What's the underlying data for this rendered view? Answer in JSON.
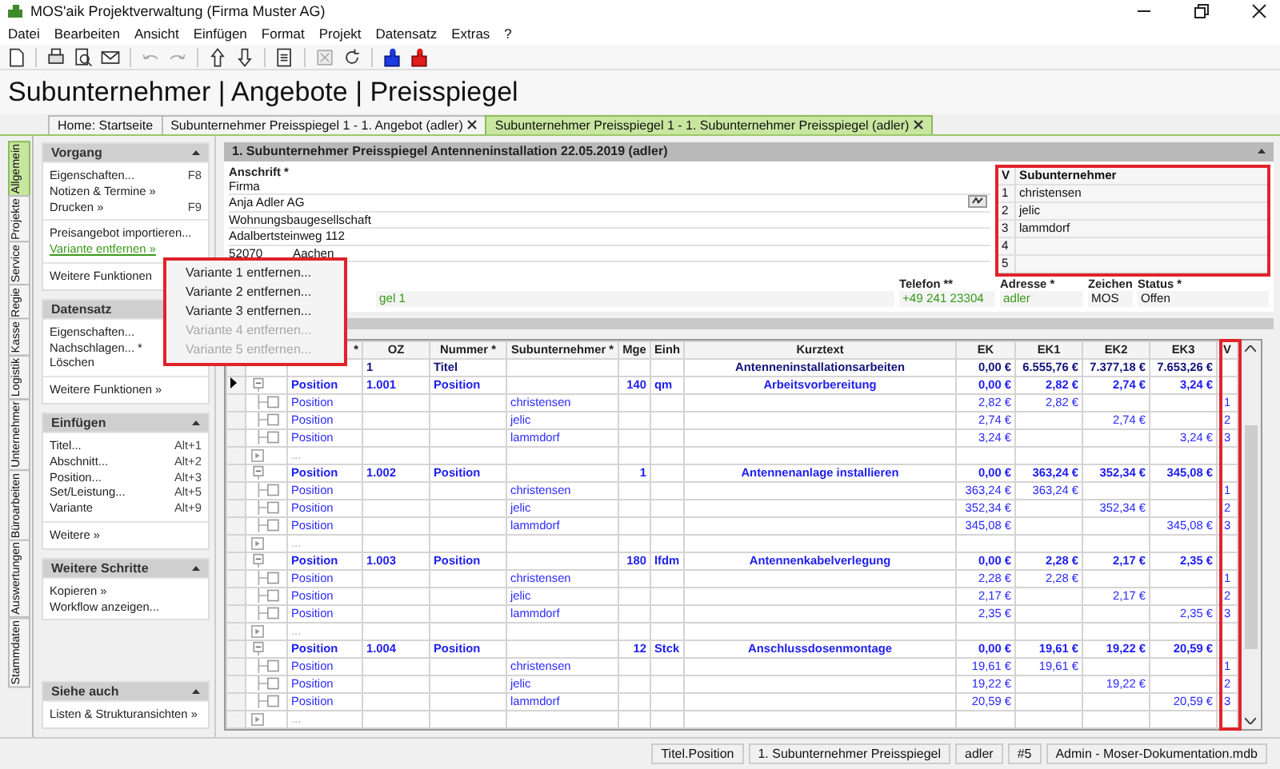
{
  "window": {
    "title": "MOS'aik Projektverwaltung (Firma Muster AG)"
  },
  "menu": [
    "Datei",
    "Bearbeiten",
    "Ansicht",
    "Einfügen",
    "Format",
    "Projekt",
    "Datensatz",
    "Extras",
    "?"
  ],
  "page_title": "Subunternehmer | Angebote | Preisspiegel",
  "tabs": [
    {
      "label": "Home: Startseite",
      "closable": false,
      "selected": false
    },
    {
      "label": "Subunternehmer Preisspiegel 1 - 1. Angebot (adler)",
      "closable": true,
      "selected": false
    },
    {
      "label": "Subunternehmer Preisspiegel 1 - 1. Subunternehmer Preisspiegel (adler)",
      "closable": true,
      "selected": true
    }
  ],
  "side_tabs": [
    {
      "label": "Allgemein",
      "selected": true
    },
    {
      "label": "Projekte",
      "selected": false
    },
    {
      "label": "Service",
      "selected": false
    },
    {
      "label": "Regie",
      "selected": false
    },
    {
      "label": "Kasse",
      "selected": false
    },
    {
      "label": "Logistik",
      "selected": false
    },
    {
      "label": "Unternehmer",
      "selected": false
    },
    {
      "label": "Büroarbeiten",
      "selected": false
    },
    {
      "label": "Auswertungen",
      "selected": false
    },
    {
      "label": "Stammdaten",
      "selected": false
    }
  ],
  "sidebar": {
    "sections": [
      {
        "title": "Vorgang",
        "groups": [
          [
            {
              "label": "Eigenschaften...",
              "shortcut": "F8",
              "active": false
            },
            {
              "label": "Notizen & Termine »",
              "active": false
            },
            {
              "label": "Drucken »",
              "shortcut": "F9",
              "active": false
            }
          ],
          [
            {
              "label": "Preisangebot importieren...",
              "active": false
            },
            {
              "label": "Variante entfernen »",
              "active": true
            }
          ],
          [
            {
              "label": "Weitere Funktionen",
              "active": false
            }
          ]
        ]
      },
      {
        "title": "Datensatz",
        "groups": [
          [
            {
              "label": "Eigenschaften...",
              "active": false
            },
            {
              "label": "Nachschlagen... *",
              "active": false
            },
            {
              "label": "Löschen",
              "active": false
            }
          ],
          [
            {
              "label": "Weitere Funktionen »",
              "active": false
            }
          ]
        ]
      },
      {
        "title": "Einfügen",
        "groups": [
          [
            {
              "label": "Titel...",
              "shortcut": "Alt+1",
              "active": false
            },
            {
              "label": "Abschnitt...",
              "shortcut": "Alt+2",
              "active": false
            },
            {
              "label": "Position...",
              "shortcut": "Alt+3",
              "active": false
            },
            {
              "label": "Set/Leistung...",
              "shortcut": "Alt+5",
              "active": false
            },
            {
              "label": "Variante",
              "shortcut": "Alt+9",
              "active": false
            }
          ],
          [
            {
              "label": "Weitere »",
              "active": false
            }
          ]
        ]
      },
      {
        "title": "Weitere Schritte",
        "groups": [
          [
            {
              "label": "Kopieren »",
              "active": false
            },
            {
              "label": "Workflow anzeigen...",
              "active": false
            }
          ]
        ]
      },
      {
        "title": "Siehe auch",
        "groups": [
          [
            {
              "label": "Listen & Strukturansichten »",
              "active": false
            }
          ]
        ]
      }
    ]
  },
  "popup": [
    {
      "label": "Variante 1 entfernen...",
      "disabled": false
    },
    {
      "label": "Variante 2 entfernen...",
      "disabled": false
    },
    {
      "label": "Variante 3 entfernen...",
      "disabled": false
    },
    {
      "label": "Variante 4 entfernen...",
      "disabled": true
    },
    {
      "label": "Variante 5 entfernen...",
      "disabled": true
    }
  ],
  "header": {
    "title": "1. Subunternehmer Preisspiegel Antenneninstallation 22.05.2019 (adler)"
  },
  "address": {
    "label": "Anschrift *",
    "lines": [
      "Firma",
      "Anja Adler AG",
      "Wohnungsbaugesellschaft",
      "Adalbertsteinweg 112"
    ],
    "zip": "52070",
    "city": "Aachen"
  },
  "subcontractors": {
    "columns": [
      "V",
      "Subunternehmer"
    ],
    "rows": [
      {
        "v": "1",
        "name": "christensen"
      },
      {
        "v": "2",
        "name": "jelic"
      },
      {
        "v": "3",
        "name": "lammdorf"
      },
      {
        "v": "4"
      },
      {
        "v": "5"
      }
    ]
  },
  "fields": [
    {
      "value": "gel 1",
      "kind": "link"
    },
    {
      "label": "Telefon **",
      "value": "+49 241 23304",
      "kind": "link"
    },
    {
      "label": "Adresse *",
      "value": "adler",
      "kind": "link"
    },
    {
      "label": "Zeichen",
      "value": "MOS",
      "kind": "plain"
    },
    {
      "label": "Status *",
      "value": "Offen",
      "kind": "plain"
    }
  ],
  "grid": {
    "columns": [
      {
        "label": "*"
      },
      {
        "label": "OZ"
      },
      {
        "label": "Nummer *"
      },
      {
        "label": "Subunternehmer *"
      },
      {
        "label": "Mge"
      },
      {
        "label": "Einh"
      },
      {
        "label": "Kurztext"
      },
      {
        "label": "EK"
      },
      {
        "label": "EK1"
      },
      {
        "label": "EK2"
      },
      {
        "label": "EK3"
      },
      {
        "label": "V"
      }
    ],
    "rows": [
      {
        "kind": "title",
        "current": false,
        "oz": "1",
        "nr": "Titel",
        "kt": "Antenneninstallationsarbeiten",
        "ek": "0,00 €",
        "ek1": "6.555,76 €",
        "ek2": "7.377,18 €",
        "ek3": "7.653,26 €"
      },
      {
        "kind": "position",
        "current": true,
        "c1": "Position",
        "oz": "1.001",
        "nr": "Position",
        "mge": "140",
        "einh": "qm",
        "kt": "Arbeitsvorbereitung",
        "ek": "0,00 €",
        "ek1": "2,82 €",
        "ek2": "2,74 €",
        "ek3": "3,24 €"
      },
      {
        "kind": "variant",
        "current": false,
        "c1": "Position",
        "sub": "christensen",
        "ek": "2,82 €",
        "ek1": "2,82 €",
        "v": "1"
      },
      {
        "kind": "variant",
        "current": false,
        "c1": "Position",
        "sub": "jelic",
        "ek": "2,74 €",
        "ek2": "2,74 €",
        "v": "2"
      },
      {
        "kind": "variant",
        "current": false,
        "c1": "Position",
        "sub": "lammdorf",
        "ek": "3,24 €",
        "ek3": "3,24 €",
        "v": "3"
      },
      {
        "kind": "more",
        "current": false,
        "c1": "..."
      },
      {
        "kind": "position",
        "current": false,
        "c1": "Position",
        "oz": "1.002",
        "nr": "Position",
        "mge": "1",
        "kt": "Antennenanlage installieren",
        "ek": "0,00 €",
        "ek1": "363,24 €",
        "ek2": "352,34 €",
        "ek3": "345,08 €"
      },
      {
        "kind": "variant",
        "current": false,
        "c1": "Position",
        "sub": "christensen",
        "ek": "363,24 €",
        "ek1": "363,24 €",
        "v": "1"
      },
      {
        "kind": "variant",
        "current": false,
        "c1": "Position",
        "sub": "jelic",
        "ek": "352,34 €",
        "ek2": "352,34 €",
        "v": "2"
      },
      {
        "kind": "variant",
        "current": false,
        "c1": "Position",
        "sub": "lammdorf",
        "ek": "345,08 €",
        "ek3": "345,08 €",
        "v": "3"
      },
      {
        "kind": "more",
        "current": false,
        "c1": "..."
      },
      {
        "kind": "position",
        "current": false,
        "c1": "Position",
        "oz": "1.003",
        "nr": "Position",
        "mge": "180",
        "einh": "lfdm",
        "kt": "Antennenkabelverlegung",
        "ek": "0,00 €",
        "ek1": "2,28 €",
        "ek2": "2,17 €",
        "ek3": "2,35 €"
      },
      {
        "kind": "variant",
        "current": false,
        "c1": "Position",
        "sub": "christensen",
        "ek": "2,28 €",
        "ek1": "2,28 €",
        "v": "1"
      },
      {
        "kind": "variant",
        "current": false,
        "c1": "Position",
        "sub": "jelic",
        "ek": "2,17 €",
        "ek2": "2,17 €",
        "v": "2"
      },
      {
        "kind": "variant",
        "current": false,
        "c1": "Position",
        "sub": "lammdorf",
        "ek": "2,35 €",
        "ek3": "2,35 €",
        "v": "3"
      },
      {
        "kind": "more",
        "current": false,
        "c1": "..."
      },
      {
        "kind": "position",
        "current": false,
        "c1": "Position",
        "oz": "1.004",
        "nr": "Position",
        "mge": "12",
        "einh": "Stck",
        "kt": "Anschlussdosenmontage",
        "ek": "0,00 €",
        "ek1": "19,61 €",
        "ek2": "19,22 €",
        "ek3": "20,59 €"
      },
      {
        "kind": "variant",
        "current": false,
        "c1": "Position",
        "sub": "christensen",
        "ek": "19,61 €",
        "ek1": "19,61 €",
        "v": "1"
      },
      {
        "kind": "variant",
        "current": false,
        "c1": "Position",
        "sub": "jelic",
        "ek": "19,22 €",
        "ek2": "19,22 €",
        "v": "2"
      },
      {
        "kind": "variant",
        "current": false,
        "c1": "Position",
        "sub": "lammdorf",
        "ek": "20,59 €",
        "ek3": "20,59 €",
        "v": "3"
      },
      {
        "kind": "more",
        "current": false,
        "c1": "..."
      }
    ]
  },
  "status_bar": [
    "Titel.Position",
    "1. Subunternehmer Preisspiegel",
    "adler",
    "#5",
    "Admin - Moser-Dokumentation.mdb"
  ]
}
